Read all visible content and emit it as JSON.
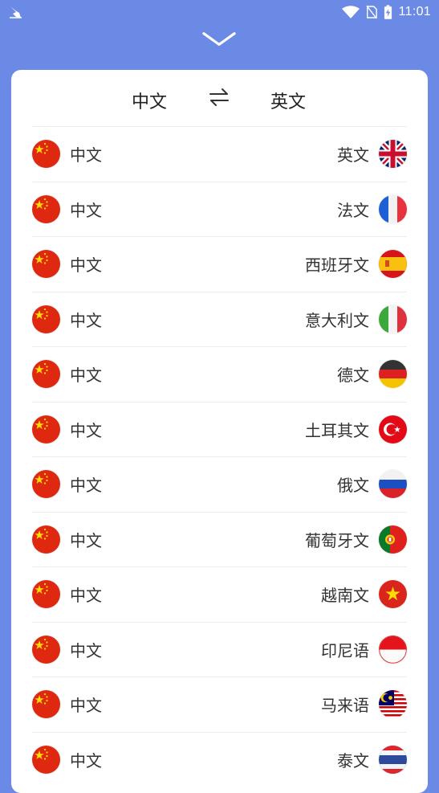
{
  "status_bar": {
    "time": "11:01",
    "icons": [
      "app-notification-icon",
      "wifi-icon",
      "no-sim-icon",
      "battery-charging-icon"
    ]
  },
  "header": {
    "source_language": "中文",
    "target_language": "英文",
    "swap_icon": "swap-arrows-icon",
    "collapse_icon": "chevron-down-icon"
  },
  "pairs": [
    {
      "source": "中文",
      "target": "英文",
      "target_flag": "uk-flag-icon"
    },
    {
      "source": "中文",
      "target": "法文",
      "target_flag": "france-flag-icon"
    },
    {
      "source": "中文",
      "target": "西班牙文",
      "target_flag": "spain-flag-icon"
    },
    {
      "source": "中文",
      "target": "意大利文",
      "target_flag": "italy-flag-icon"
    },
    {
      "source": "中文",
      "target": "德文",
      "target_flag": "germany-flag-icon"
    },
    {
      "source": "中文",
      "target": "土耳其文",
      "target_flag": "turkey-flag-icon"
    },
    {
      "source": "中文",
      "target": "俄文",
      "target_flag": "russia-flag-icon"
    },
    {
      "source": "中文",
      "target": "葡萄牙文",
      "target_flag": "portugal-flag-icon"
    },
    {
      "source": "中文",
      "target": "越南文",
      "target_flag": "vietnam-flag-icon"
    },
    {
      "source": "中文",
      "target": "印尼语",
      "target_flag": "indonesia-flag-icon"
    },
    {
      "source": "中文",
      "target": "马来语",
      "target_flag": "malaysia-flag-icon"
    },
    {
      "source": "中文",
      "target": "泰文",
      "target_flag": "thailand-flag-icon"
    }
  ],
  "colors": {
    "background": "#6a8ae6",
    "card": "#ffffff",
    "text": "#333333"
  }
}
